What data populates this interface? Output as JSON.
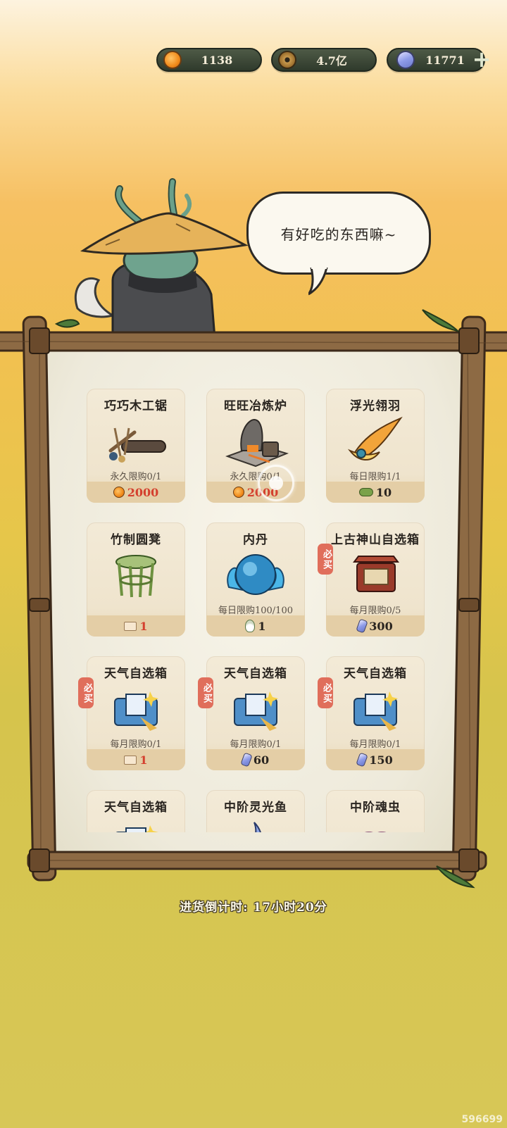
{
  "currencies": [
    {
      "icon": "peach-icon",
      "value": "1138"
    },
    {
      "icon": "copper-coin-icon",
      "value": "4.7亿"
    },
    {
      "icon": "crystal-icon",
      "value": "11771"
    }
  ],
  "npc": {
    "speech": "有好吃的东西嘛~"
  },
  "shop": {
    "items": [
      {
        "name": "巧巧木工锯",
        "limit": "永久限购0/1",
        "price": "2000",
        "currency": "peach",
        "price_color": "#d4402e",
        "badge": ""
      },
      {
        "name": "旺旺冶炼炉",
        "limit": "永久限购0/1",
        "price": "2000",
        "currency": "peach",
        "price_color": "#d4402e",
        "badge": ""
      },
      {
        "name": "浮光翎羽",
        "limit": "每日限购1/1",
        "price": "10",
        "currency": "leaf",
        "price_color": "#2a2520",
        "badge": ""
      },
      {
        "name": "竹制圆凳",
        "limit": "",
        "price": "1",
        "currency": "ticket",
        "price_color": "#d4402e",
        "badge": ""
      },
      {
        "name": "内丹",
        "limit": "每日限购100/100",
        "price": "1",
        "currency": "herb",
        "price_color": "#2a2520",
        "badge": ""
      },
      {
        "name": "上古神山自选箱",
        "limit": "每月限购0/5",
        "price": "300",
        "currency": "crystal",
        "price_color": "#2a2520",
        "badge": "必买"
      },
      {
        "name": "天气自选箱",
        "limit": "每月限购0/1",
        "price": "1",
        "currency": "ticket",
        "price_color": "#d4402e",
        "badge": "必买"
      },
      {
        "name": "天气自选箱",
        "limit": "每月限购0/1",
        "price": "60",
        "currency": "crystal",
        "price_color": "#2a2520",
        "badge": "必买"
      },
      {
        "name": "天气自选箱",
        "limit": "每月限购0/1",
        "price": "150",
        "currency": "crystal",
        "price_color": "#2a2520",
        "badge": "必买"
      },
      {
        "name": "天气自选箱",
        "limit": "",
        "price": "",
        "currency": "",
        "price_color": "#2a2520",
        "badge": ""
      },
      {
        "name": "中阶灵光鱼",
        "limit": "",
        "price": "",
        "currency": "",
        "price_color": "#2a2520",
        "badge": ""
      },
      {
        "name": "中阶魂虫",
        "limit": "",
        "price": "",
        "currency": "",
        "price_color": "#2a2520",
        "badge": ""
      }
    ]
  },
  "restock": {
    "label": "进货倒计时: 17小时20分"
  },
  "watermark": "596699"
}
